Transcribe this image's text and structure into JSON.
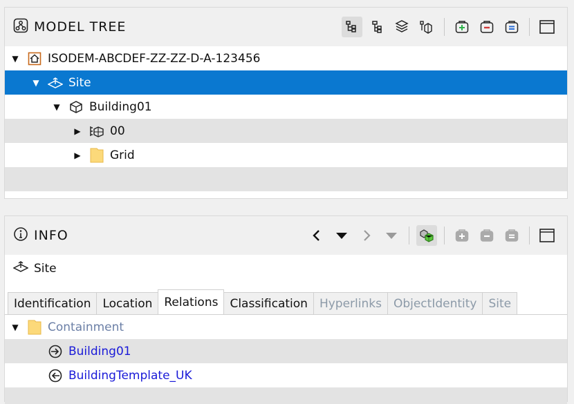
{
  "model_tree": {
    "title": "MODEL TREE",
    "toolbar": [
      "hierarchy-view-icon",
      "flat-tree-icon",
      "layers-view-icon",
      "grouped-view-icon",
      "expand-all-icon",
      "collapse-all-icon",
      "filter-icon",
      "maximize-panel-icon"
    ],
    "nodes": [
      {
        "label": "ISODEM-ABCDEF-ZZ-ZZ-D-A-123456",
        "icon": "project-icon",
        "expanded": true,
        "selected": false
      },
      {
        "label": "Site",
        "icon": "site-icon",
        "expanded": true,
        "selected": true
      },
      {
        "label": "Building01",
        "icon": "building-icon",
        "expanded": true,
        "selected": false
      },
      {
        "label": "00",
        "icon": "storey-icon",
        "expanded": false,
        "selected": false
      },
      {
        "label": "Grid",
        "icon": "folder-icon",
        "expanded": false,
        "selected": false
      }
    ]
  },
  "info": {
    "title": "INFO",
    "selected_object": "Site",
    "tabs": [
      {
        "label": "Identification",
        "state": "normal"
      },
      {
        "label": "Location",
        "state": "normal"
      },
      {
        "label": "Relations",
        "state": "active"
      },
      {
        "label": "Classification",
        "state": "normal"
      },
      {
        "label": "Hyperlinks",
        "state": "disabled"
      },
      {
        "label": "ObjectIdentity",
        "state": "disabled"
      },
      {
        "label": "Site",
        "state": "disabled"
      }
    ],
    "relations": {
      "group": "Containment",
      "items": [
        {
          "label": "Building01",
          "direction": "in"
        },
        {
          "label": "BuildingTemplate_UK",
          "direction": "out"
        }
      ]
    }
  },
  "colors": {
    "selection": "#0a78d0",
    "link": "#1a1ad8",
    "folder": "#fcd97a",
    "accent_green": "#2db34a",
    "accent_red": "#d13a3a",
    "accent_blue": "#2b6fd6"
  }
}
